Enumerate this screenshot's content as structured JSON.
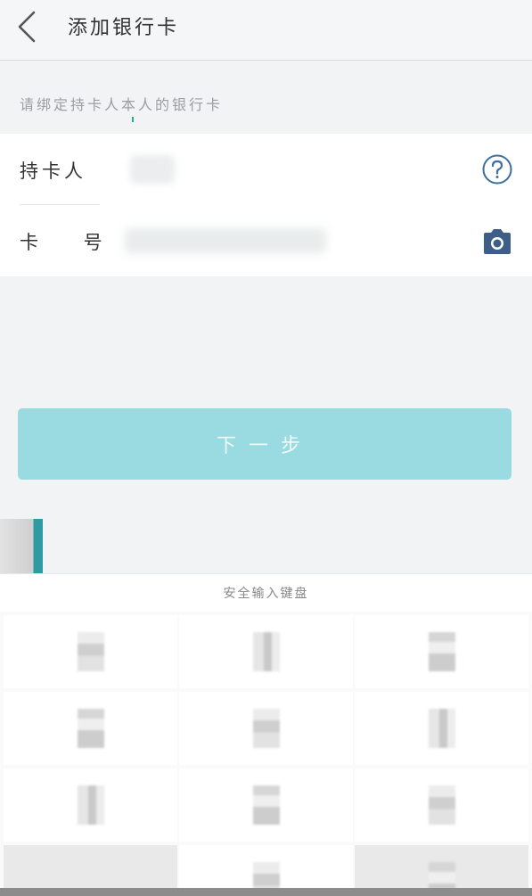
{
  "header": {
    "title": "添加银行卡",
    "back_icon": "chevron-left-icon"
  },
  "hint": "请绑定持卡人本人的银行卡",
  "form": {
    "cardholder": {
      "label": "持卡人",
      "icon": "help-circle-icon"
    },
    "card_number": {
      "label": "卡  号",
      "icon": "camera-icon"
    }
  },
  "next_button": {
    "label": "下一步"
  },
  "keyboard": {
    "title": "安全输入键盘"
  },
  "colors": {
    "accent": "#99dbe0",
    "icon_blue": "#3d5f87",
    "background": "#f1f3f4"
  }
}
